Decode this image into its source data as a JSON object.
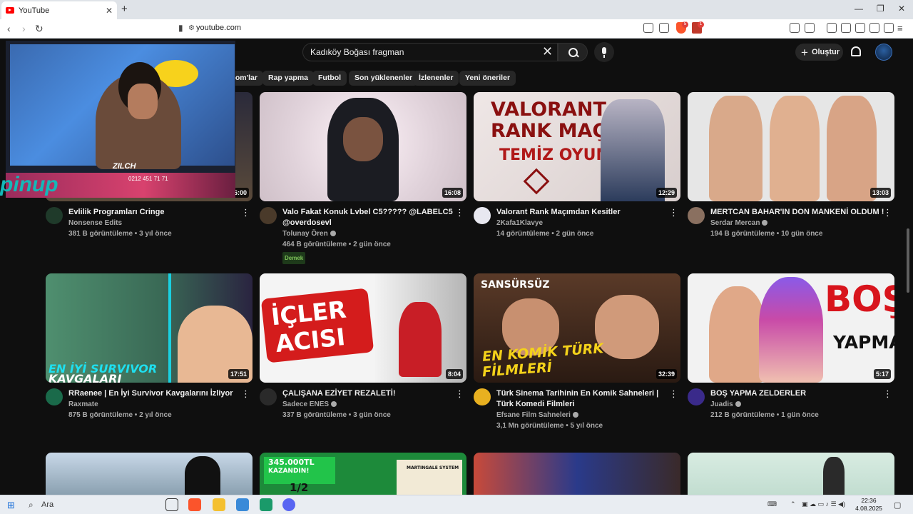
{
  "browser": {
    "tab_title": "YouTube",
    "url": "youtube.com",
    "new_tab": "+",
    "badges": [
      "5",
      "1"
    ]
  },
  "youtube": {
    "search_value": "Kadıköy Boğası fragman",
    "create_label": "Oluştur",
    "chips": [
      "com'lar",
      "Rap yapma",
      "Futbol",
      "Son yüklenenler",
      "İzlenenler",
      "Yeni öneriler"
    ]
  },
  "videos": [
    {
      "title": "Evlilik Programları Cringe",
      "channel": "Nonsense Edits",
      "verified": false,
      "stats": "381 B görüntüleme • 3 yıl önce",
      "duration": "6:00",
      "tag": ""
    },
    {
      "title": "Valo Fakat Konuk Lvbel C5????? @LABELC5 @overdosevl",
      "channel": "Tolunay Ören",
      "verified": true,
      "stats": "464 B görüntüleme • 2 gün önce",
      "duration": "16:08",
      "tag": "Demek"
    },
    {
      "title": "Valorant Rank Maçımdan Kesitler",
      "channel": "2Kafa1Klavye",
      "verified": false,
      "stats": "14 görüntüleme • 2 gün önce",
      "duration": "12:29",
      "tag": ""
    },
    {
      "title": "MERTCAN BAHAR'IN DON MANKENİ OLDUM !",
      "channel": "Serdar Mercan",
      "verified": true,
      "stats": "194 B görüntüleme • 10 gün önce",
      "duration": "13:03",
      "tag": ""
    },
    {
      "title": "RRaenee | En İyi Survivor Kavgalarını İzliyor",
      "channel": "Raxmate",
      "verified": false,
      "stats": "875 B görüntüleme • 2 yıl önce",
      "duration": "17:51",
      "tag": ""
    },
    {
      "title": "ÇALIŞANA EZİYET REZALETİ!",
      "channel": "Sadece ENES",
      "verified": true,
      "stats": "337 B görüntüleme • 3 gün önce",
      "duration": "8:04",
      "tag": ""
    },
    {
      "title": "Türk Sinema Tarihinin En Komik Sahneleri | Türk Komedi Filmleri",
      "channel": "Efsane Film Sahneleri",
      "verified": true,
      "stats": "3,1 Mn görüntüleme • 5 yıl önce",
      "duration": "32:39",
      "tag": ""
    },
    {
      "title": "BOŞ YAPMA ZELDERLER",
      "channel": "Juadis",
      "verified": true,
      "stats": "212 B görüntüleme • 1 gün önce",
      "duration": "5:17",
      "tag": ""
    }
  ],
  "thumb_text": {
    "valorant_1": "VALORANT",
    "valorant_2": "RANK MAÇI",
    "valorant_3": "TEMİZ OYUN",
    "survivor_1": "EN İYİ SURVIVOR",
    "survivor_2": "KAVGALARI",
    "icler_1": "İÇLER",
    "icler_2": "ACISI",
    "sansursuz": "SANSÜRSÜZ",
    "komik_1": "EN KOMİK TÜRK",
    "komik_2": "FİLMLERİ",
    "bos_1": "BOŞ",
    "bos_2": "YAPMA",
    "casino_1": "345.000TL",
    "casino_2": "KAZANDIN!",
    "casino_3": "1/2",
    "casino_4": "MARTINGALE SYSTEM"
  },
  "pip": {
    "name": "ZILCH",
    "phone": "0212 451 71 71",
    "brand": "pinup"
  },
  "taskbar": {
    "search_label": "Ara",
    "time": "22:36",
    "date": "4.08.2025"
  },
  "colors": {
    "background": "#0f0f0f",
    "accent_red": "#ff0000",
    "chip_bg": "#272727"
  }
}
